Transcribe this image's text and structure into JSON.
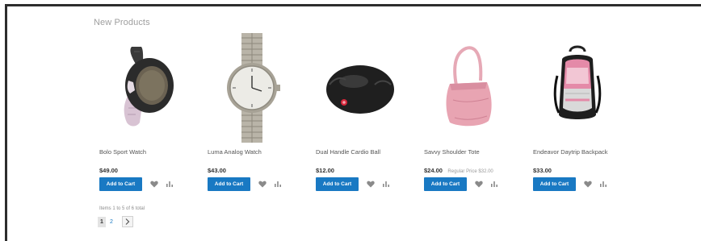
{
  "section": {
    "title": "New Products"
  },
  "products": [
    {
      "name": "Bolo Sport Watch",
      "price": "$49.00",
      "regular_price": "",
      "add_to_cart_label": "Add to Cart",
      "image_icon": "sport-watch-image"
    },
    {
      "name": "Luma Analog Watch",
      "price": "$43.00",
      "regular_price": "",
      "add_to_cart_label": "Add to Cart",
      "image_icon": "analog-watch-image"
    },
    {
      "name": "Dual Handle Cardio Ball",
      "price": "$12.00",
      "regular_price": "",
      "add_to_cart_label": "Add to Cart",
      "image_icon": "cardio-ball-image"
    },
    {
      "name": "Savvy Shoulder Tote",
      "price": "$24.00",
      "regular_price": "Regular Price $32.00",
      "add_to_cart_label": "Add to Cart",
      "image_icon": "shoulder-tote-image"
    },
    {
      "name": "Endeavor Daytrip Backpack",
      "price": "$33.00",
      "regular_price": "",
      "add_to_cart_label": "Add to Cart",
      "image_icon": "backpack-image"
    }
  ],
  "pager": {
    "info": "Items 1 to 5 of 6 total",
    "current_page": "1",
    "next_page": "2"
  },
  "colors": {
    "accent": "#1979c3",
    "frame_border": "#2d2d2d"
  }
}
